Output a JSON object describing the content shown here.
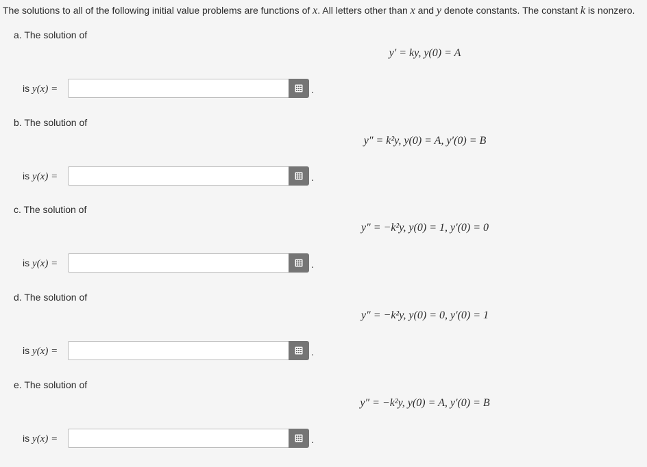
{
  "intro": {
    "t1": "The solutions to all of the following initial value problems are functions of ",
    "v1": "x",
    "t2": ". All letters other than ",
    "v2": "x",
    "t3": " and ",
    "v3": "y",
    "t4": " denote constants. The constant ",
    "v4": "k",
    "t5": " is nonzero."
  },
  "is_prefix": "is",
  "y_of_x": "y(x) =",
  "period": ".",
  "keypad_icon": "keypad-icon",
  "parts": [
    {
      "label": "a. The solution of",
      "equation": "y′ = ky,   y(0) = A",
      "answer": ""
    },
    {
      "label": "b. The solution of",
      "equation": "y″ = k²y,   y(0) = A,   y′(0) = B",
      "answer": ""
    },
    {
      "label": "c. The solution of",
      "equation": "y″ = −k²y,   y(0) = 1,   y′(0) = 0",
      "answer": ""
    },
    {
      "label": "d. The solution of",
      "equation": "y″ = −k²y,   y(0) = 0,   y′(0) = 1",
      "answer": ""
    },
    {
      "label": "e. The solution of",
      "equation": "y″ = −k²y,   y(0) = A,   y′(0) = B",
      "answer": ""
    }
  ]
}
